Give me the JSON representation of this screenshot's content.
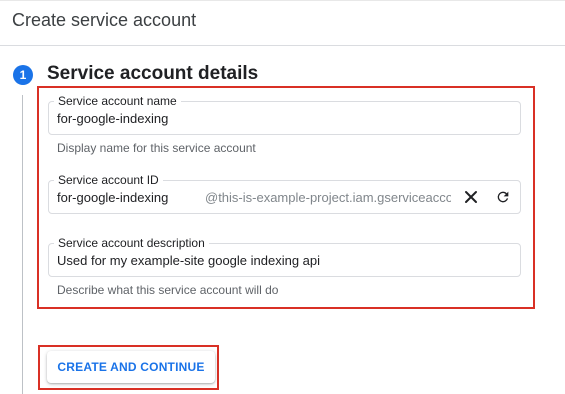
{
  "page": {
    "title": "Create service account"
  },
  "step": {
    "number": "1",
    "title": "Service account details"
  },
  "fields": {
    "name": {
      "label": "Service account name",
      "value": "for-google-indexing",
      "hint": "Display name for this service account"
    },
    "id": {
      "label": "Service account ID",
      "value": "for-google-indexing",
      "suffix": "@this-is-example-project.iam.gserviceacco",
      "clear_icon": "close-icon",
      "refresh_icon": "refresh-icon"
    },
    "description": {
      "label": "Service account description",
      "value": "Used for my example-site google indexing api",
      "hint": "Describe what this service account will do"
    }
  },
  "actions": {
    "create_label": "CREATE AND CONTINUE"
  },
  "colors": {
    "accent": "#1a73e8",
    "highlight": "#d93025"
  }
}
